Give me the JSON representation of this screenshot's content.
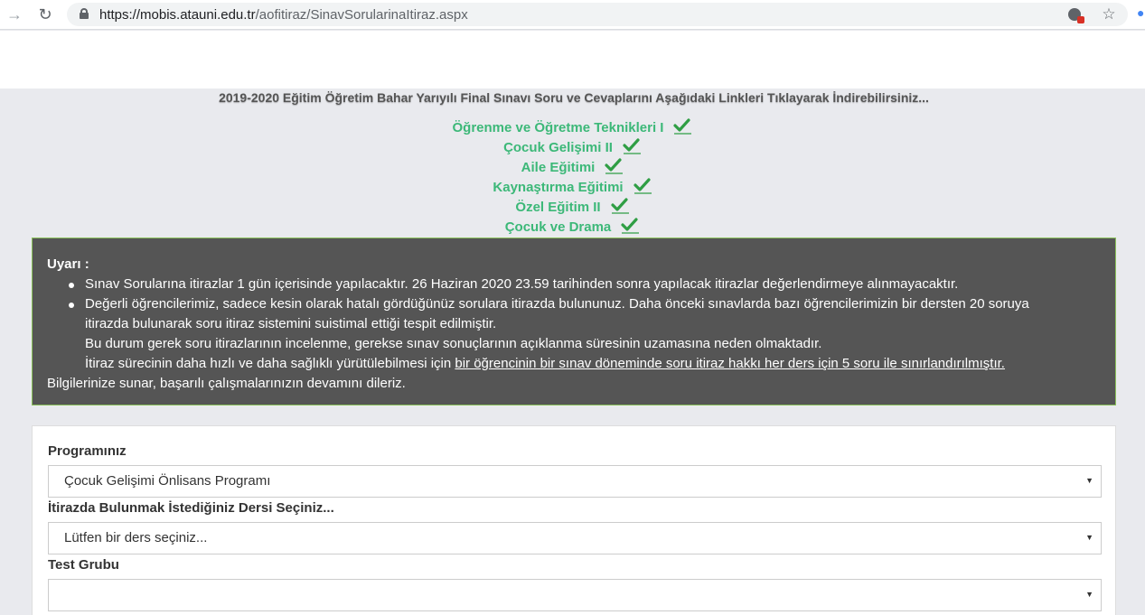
{
  "browser": {
    "url_host": "https://mobis.atauni.edu.tr",
    "url_path": "/aofitiraz/SinavSorularinaItiraz.aspx"
  },
  "page": {
    "title": "2019-2020 Eğitim Öğretim Bahar Yarıyılı Final Sınavı Soru ve Cevaplarını Aşağıdaki Linkleri Tıklayarak İndirebilirsiniz...",
    "links": [
      "Öğrenme ve Öğretme Teknikleri I",
      "Çocuk Gelişimi II",
      "Aile Eğitimi",
      "Kaynaştırma Eğitimi",
      "Özel Eğitim II",
      "Çocuk ve Drama"
    ],
    "link_color": "#3cb878"
  },
  "warning": {
    "title": "Uyarı :",
    "item1": "Sınav Sorularına itirazlar 1 gün içerisinde yapılacaktır. 26 Haziran 2020 23.59 tarihinden sonra yapılacak itirazlar değerlendirmeye alınmayacaktır.",
    "item2_line1": "Değerli öğrencilerimiz, sadece kesin olarak hatalı gördüğünüz sorulara itirazda bulununuz. Daha önceki sınavlarda bazı öğrencilerimizin bir dersten 20 soruya",
    "item2_line2": "itirazda bulunarak soru itiraz sistemini suistimal ettiği tespit edilmiştir.",
    "item2_line3": "Bu durum gerek soru itirazlarının incelenme, gerekse sınav sonuçlarının açıklanma süresinin uzamasına neden olmaktadır.",
    "item2_line4_prefix": "İtiraz sürecinin daha hızlı ve daha sağlıklı yürütülebilmesi için ",
    "item2_line4_underlined": "bir öğrencinin bir sınav döneminde soru itiraz hakkı her ders için 5 soru ile sınırlandırılmıştır.",
    "closing": "Bilgilerinize sunar, başarılı çalışmalarınızın devamını dileriz.",
    "bg_color": "#555555",
    "border_color": "#8ac05a"
  },
  "form": {
    "program_label": "Programınız",
    "program_value": "Çocuk Gelişimi Önlisans Programı",
    "course_label": "İtirazda Bulunmak İstediğiniz Dersi Seçiniz...",
    "course_value": "Lütfen bir ders seçiniz...",
    "group_label": "Test Grubu",
    "group_value": ""
  }
}
